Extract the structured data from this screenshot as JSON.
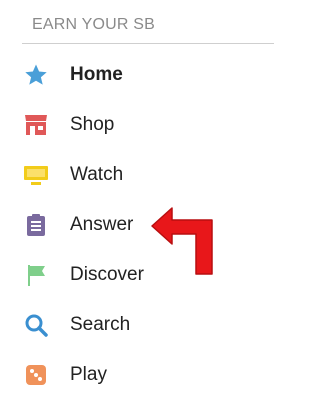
{
  "header": {
    "title": "EARN YOUR SB"
  },
  "menu": {
    "items": [
      {
        "label": "Home",
        "icon": "star-icon"
      },
      {
        "label": "Shop",
        "icon": "shop-icon"
      },
      {
        "label": "Watch",
        "icon": "tv-icon"
      },
      {
        "label": "Answer",
        "icon": "clipboard-icon"
      },
      {
        "label": "Discover",
        "icon": "flag-icon"
      },
      {
        "label": "Search",
        "icon": "magnifier-icon"
      },
      {
        "label": "Play",
        "icon": "dice-icon"
      }
    ]
  },
  "colors": {
    "star": "#4a9fd8",
    "shop": "#e05858",
    "tv": "#f2cc1a",
    "clipboard": "#7a6a9e",
    "flag": "#7fcf8b",
    "magnifier": "#3a8fd0",
    "dice": "#f0925a",
    "arrow": "#e8171a"
  }
}
